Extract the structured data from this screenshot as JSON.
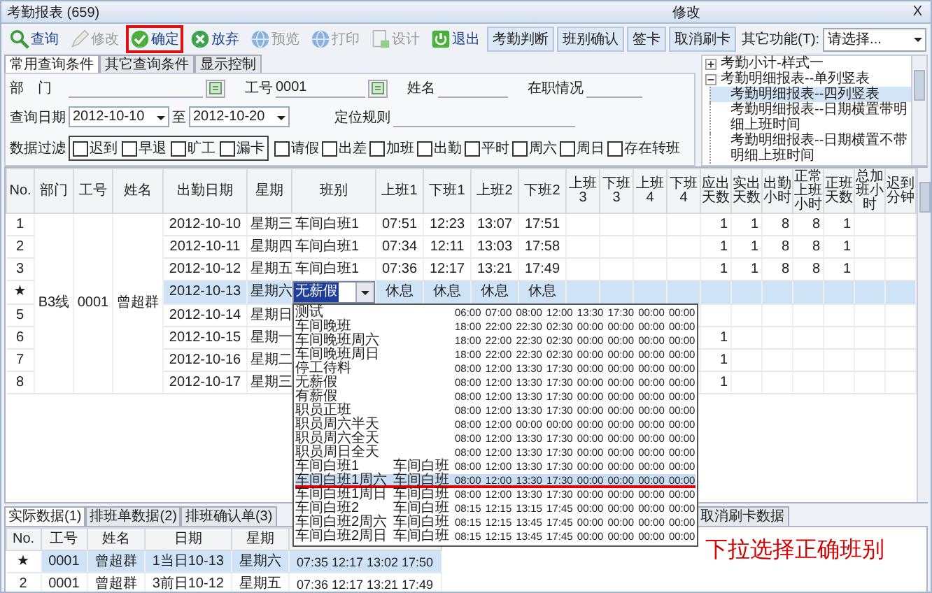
{
  "window": {
    "title": "考勤报表 (659)",
    "mode": "修改",
    "close": "X"
  },
  "toolbar": {
    "tools": [
      {
        "label": "查询",
        "disabled": false,
        "annotated": false
      },
      {
        "label": "修改",
        "disabled": true,
        "annotated": false
      },
      {
        "label": "确定",
        "disabled": false,
        "annotated": true
      },
      {
        "label": "放弃",
        "disabled": false,
        "annotated": false
      },
      {
        "label": "预览",
        "disabled": true,
        "annotated": false
      },
      {
        "label": "打印",
        "disabled": true,
        "annotated": false
      },
      {
        "label": "设计",
        "disabled": true,
        "annotated": false
      },
      {
        "label": "退出",
        "disabled": false,
        "annotated": false
      }
    ],
    "buttons": [
      "考勤判断",
      "班别确认",
      "签卡",
      "取消刷卡"
    ],
    "other_label": "其它功能(T):",
    "other_select": "请选择..."
  },
  "query_tabs": [
    {
      "label": "常用查询条件",
      "selected": true
    },
    {
      "label": "其它查询条件",
      "selected": false
    },
    {
      "label": "显示控制",
      "selected": false
    }
  ],
  "filters": {
    "department": {
      "label": "部　门"
    },
    "employee_id": {
      "label": "工号",
      "value": "0001"
    },
    "name": {
      "label": "姓名"
    },
    "status": {
      "label": "在职情况"
    },
    "date_label": "查询日期",
    "date_from": "2012-10-10",
    "to": "至",
    "date_to": "2012-10-20",
    "locate": {
      "label": "定位规则"
    },
    "data_filter": {
      "label": "数据过滤",
      "boxed": [
        {
          "label": "迟到",
          "checked": false
        },
        {
          "label": "早退",
          "checked": false
        },
        {
          "label": "旷工",
          "checked": false
        },
        {
          "label": "漏卡",
          "checked": false
        }
      ],
      "others": [
        {
          "label": "请假",
          "checked": false
        },
        {
          "label": "出差",
          "checked": false
        },
        {
          "label": "加班",
          "checked": false
        },
        {
          "label": "出勤",
          "checked": false
        },
        {
          "label": "平时",
          "checked": false
        },
        {
          "label": "周六",
          "checked": false
        },
        {
          "label": "周日",
          "checked": false
        },
        {
          "label": "存在转班",
          "checked": false
        }
      ]
    }
  },
  "report_tree": [
    {
      "label": "考勤小计-样式一",
      "expanded": false,
      "selected": false
    },
    {
      "label": "考勤明细报表--单列竖表",
      "expanded": true,
      "selected": false,
      "children": [
        {
          "label": "考勤明细报表--四列竖表",
          "selected": true
        },
        {
          "label": "考勤明细报表--日期横置带明细上班时间",
          "selected": false
        },
        {
          "label": "考勤明细报表--日期横置不带明细上班时间",
          "selected": false
        }
      ]
    }
  ],
  "grid": {
    "columns": [
      "No.",
      "部门",
      "工号",
      "姓名",
      "出勤日期",
      "星期",
      "班别",
      "上班1",
      "下班1",
      "上班2",
      "下班2",
      "上班3",
      "下班3",
      "上班4",
      "下班4",
      "应出天数",
      "实出天数",
      "出勤小时",
      "正常上班小时",
      "正班天数",
      "总加班小时",
      "迟到分钟"
    ],
    "group": {
      "department": "B3线",
      "employee_id": "0001",
      "name": "曾超群"
    },
    "rows": [
      {
        "no": "1",
        "date": "2012-10-10",
        "weekday": "星期三",
        "shift": "车间白班1",
        "in_1": "07:51",
        "out_1": "12:23",
        "in_2": "13:07",
        "out_2": "17:51",
        "due_days": "1",
        "actual_days": "1",
        "work_hours": "8",
        "normal_hours": "8",
        "normal_days": "1",
        "selected": false,
        "editing": false
      },
      {
        "no": "2",
        "date": "2012-10-11",
        "weekday": "星期四",
        "shift": "车间白班1",
        "in_1": "07:34",
        "out_1": "12:11",
        "in_2": "13:03",
        "out_2": "17:58",
        "due_days": "1",
        "actual_days": "1",
        "work_hours": "8",
        "normal_hours": "8",
        "normal_days": "1",
        "selected": false,
        "editing": false
      },
      {
        "no": "3",
        "date": "2012-10-12",
        "weekday": "星期五",
        "shift": "车间白班1",
        "in_1": "07:36",
        "out_1": "12:17",
        "in_2": "13:21",
        "out_2": "17:49",
        "due_days": "1",
        "actual_days": "1",
        "work_hours": "8",
        "normal_hours": "8",
        "normal_days": "1",
        "selected": false,
        "editing": false
      },
      {
        "no": "★",
        "date": "2012-10-13",
        "weekday": "星期六",
        "shift": "无薪假",
        "in_1": "休息",
        "out_1": "休息",
        "in_2": "休息",
        "out_2": "休息",
        "selected": true,
        "editing": true
      },
      {
        "no": "5",
        "date": "2012-10-14",
        "weekday": "星期日",
        "selected": false,
        "editing": false
      },
      {
        "no": "6",
        "date": "2012-10-15",
        "weekday": "星期一",
        "due_days": "1",
        "selected": false,
        "editing": false
      },
      {
        "no": "7",
        "date": "2012-10-16",
        "weekday": "星期二",
        "due_days": "1",
        "selected": false,
        "editing": false
      },
      {
        "no": "8",
        "date": "2012-10-17",
        "weekday": "星期三",
        "due_days": "1",
        "selected": false,
        "editing": false
      }
    ]
  },
  "shift_dropdown": {
    "items": [
      {
        "name": "测试",
        "times": "06:00 07:00 08:00 12:00 13:30 17:30 00:00 00:00",
        "selected": false,
        "underlined": false
      },
      {
        "name": "车间晚班",
        "times": "18:00 22:00 22:30 02:30 00:00 00:00 00:00 00:00",
        "selected": false,
        "underlined": false
      },
      {
        "name": "车间晚班周六",
        "times": "18:00 22:00 22:30 02:30 00:00 00:00 00:00 00:00",
        "selected": false,
        "underlined": false
      },
      {
        "name": "车间晚班周日",
        "times": "18:00 22:00 22:30 02:30 00:00 00:00 00:00 00:00",
        "selected": false,
        "underlined": false
      },
      {
        "name": "停工待料",
        "times": "08:00 12:00 13:30 17:30 00:00 00:00 00:00 00:00",
        "selected": false,
        "underlined": false
      },
      {
        "name": "无薪假",
        "times": "08:00 12:00 13:30 17:30 00:00 00:00 00:00 00:00",
        "selected": false,
        "underlined": false
      },
      {
        "name": "有薪假",
        "times": "08:00 12:00 13:30 17:30 00:00 00:00 00:00 00:00",
        "selected": false,
        "underlined": false
      },
      {
        "name": "职员正班",
        "times": "08:00 12:00 13:30 17:30 00:00 00:00 00:00 00:00",
        "selected": false,
        "underlined": false
      },
      {
        "name": "职员周六半天",
        "times": "08:00 12:00 00:00 00:00 00:00 00:00 00:00 00:00",
        "selected": false,
        "underlined": false
      },
      {
        "name": "职员周六全天",
        "times": "08:00 12:00 13:30 17:30 00:00 00:00 00:00 00:00",
        "selected": false,
        "underlined": false
      },
      {
        "name": "职员周日全天",
        "times": "08:00 12:00 13:30 17:30 00:00 00:00 00:00 00:00",
        "selected": false,
        "underlined": false
      },
      {
        "name": "车间白班1",
        "group": "车间白班",
        "times": "08:00 12:00 13:30 17:30 00:00 00:00 00:00 00:00",
        "selected": false,
        "underlined": false
      },
      {
        "name": "车间白班1周六",
        "group": "车间白班",
        "times": "08:00 12:00 13:30 17:30 00:00 00:00 00:00 00:00",
        "selected": true,
        "underlined": true
      },
      {
        "name": "车间白班1周日",
        "group": "车间白班",
        "times": "08:00 12:00 13:30 17:30 00:00 00:00 00:00 00:00",
        "selected": false,
        "underlined": false
      },
      {
        "name": "车间白班2",
        "group": "车间白班",
        "times": "08:15 12:15 13:15 17:45 00:00 00:00 00:00 00:00",
        "selected": false,
        "underlined": false
      },
      {
        "name": "车间白班2周六",
        "group": "车间白班",
        "times": "08:15 12:15 13:45 17:45 00:00 00:00 00:00 00:00",
        "selected": false,
        "underlined": false
      },
      {
        "name": "车间白班2周日",
        "group": "车间白班",
        "times": "08:15 12:15 13:45 17:45 00:00 00:00 00:00 00:00",
        "selected": false,
        "underlined": false
      }
    ]
  },
  "bottom_tabs": [
    {
      "label": "实际数据(1)",
      "selected": true
    },
    {
      "label": "排班单数据(2)",
      "selected": false
    },
    {
      "label": "排班确认单(3)",
      "selected": false
    },
    {
      "label": "取消刷卡数据",
      "selected": false
    }
  ],
  "bottom_grid": {
    "columns": [
      "No.",
      "工号",
      "姓名",
      "日期",
      "星期"
    ],
    "rows": [
      {
        "no": "★",
        "employee_id": "0001",
        "name": "曾超群",
        "date": "1当日10-13",
        "weekday": "星期六",
        "times": "07:35 12:17 13:02 17:50",
        "selected": true
      },
      {
        "no": "2",
        "employee_id": "0001",
        "name": "曾超群",
        "date": "3前日10-12",
        "weekday": "星期五",
        "times": "07:36 12:17 13:21 17:49",
        "selected": false
      }
    ]
  },
  "annotation": "下拉选择正确班别"
}
